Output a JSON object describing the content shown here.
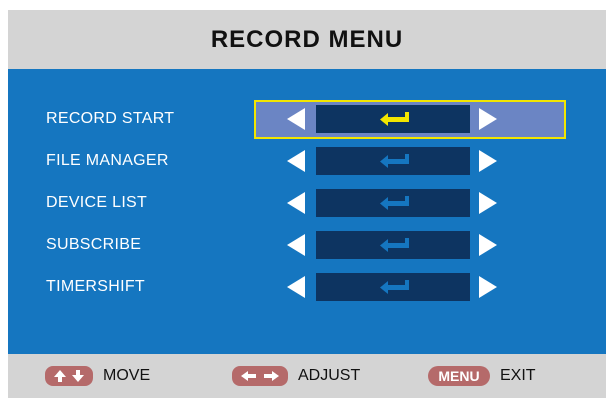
{
  "menu": {
    "title": "RECORD MENU",
    "items": [
      {
        "label": "RECORD START",
        "selected": true
      },
      {
        "label": "FILE MANAGER",
        "selected": false
      },
      {
        "label": "DEVICE LIST",
        "selected": false
      },
      {
        "label": "SUBSCRIBE",
        "selected": false
      },
      {
        "label": "TIMERSHIFT",
        "selected": false
      }
    ]
  },
  "footer": {
    "move_label": "MOVE",
    "adjust_label": "ADJUST",
    "menu_key": "MENU",
    "exit_label": "EXIT"
  },
  "colors": {
    "panel": "#1576c0",
    "value_box": "#0d3461",
    "selected_row": "#6b85c4",
    "highlight_border": "#f2e600",
    "enter_icon_active": "#f2e600",
    "enter_icon_inactive": "#1576c0",
    "key_badge": "#b56a6a"
  },
  "icons": {
    "left": "arrow-left-icon",
    "right": "arrow-right-icon",
    "enter": "enter-return-icon",
    "move": "up-down-arrows-icon",
    "adjust": "left-right-arrows-icon"
  }
}
